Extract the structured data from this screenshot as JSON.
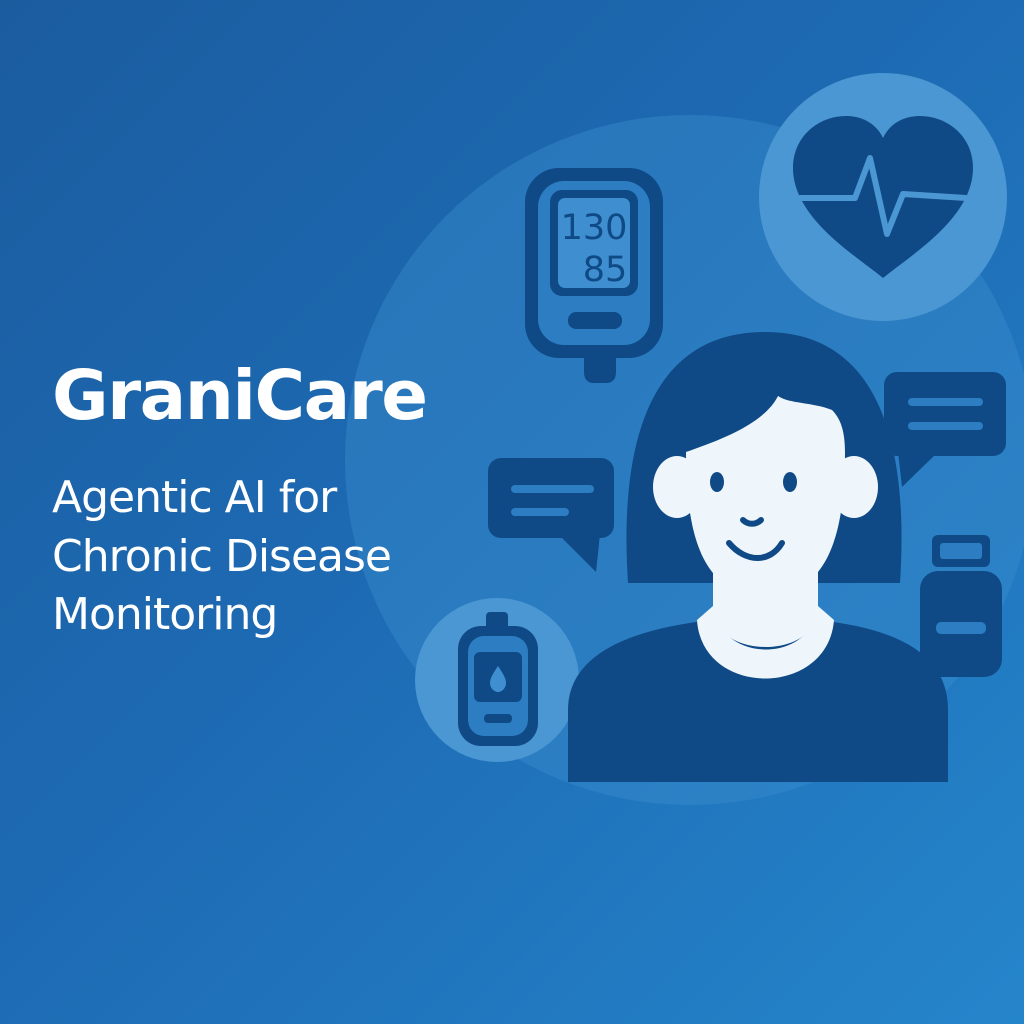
{
  "hero": {
    "title": "GraniCare",
    "subtitle_lines": [
      "Agentic AI for",
      "Chronic Disease",
      "Monitoring"
    ]
  },
  "device": {
    "systolic": "130",
    "diastolic": "85"
  },
  "icons": [
    "blood-pressure-monitor-icon",
    "heart-pulse-icon",
    "chat-bubble-icon",
    "glucose-meter-icon",
    "medicine-bottle-icon",
    "patient-avatar-icon"
  ],
  "colors": {
    "background_start": "#1b5c9f",
    "background_end": "#2585cb",
    "icon_dark": "#0f4a86",
    "icon_light": "#eef6fc",
    "accent_circle": "#4b97d3"
  }
}
